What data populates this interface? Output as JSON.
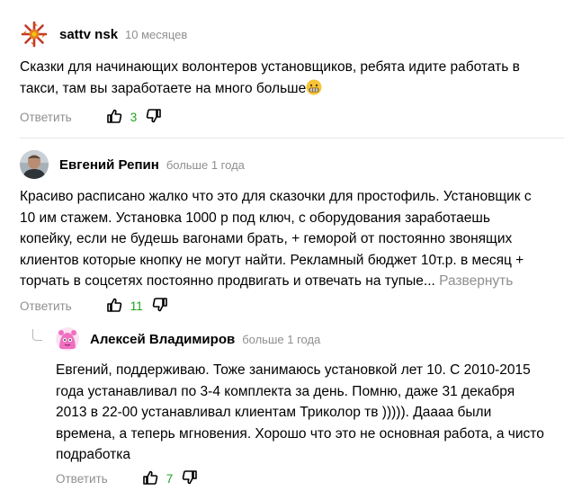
{
  "comments": [
    {
      "author": "sattv nsk",
      "date": "10 месяцев",
      "lines": [
        "Сказки для начинающих волонтеров установщиков, ребята идите работать в",
        "такси, там вы заработаете на много больше"
      ],
      "reply_label": "Ответить",
      "likes": "3"
    },
    {
      "author": "Евгений Репин",
      "date": "больше 1 года",
      "lines": [
        "Красиво расписано жалко что это для сказочки для простофиль. Установщик с",
        "10 им стажем. Установка 1000 р под ключ, с оборудования заработаешь",
        "копейку, если не будешь вагонами брать, + геморой от постоянно звонящих",
        "клиентов которые кнопку не могут найти. Рекламный бюджет 10т.р. в месяц +",
        "торчать в соцсетях постоянно продвигать и отвечать на тупые..."
      ],
      "expand_label": "Развернуть",
      "reply_label": "Ответить",
      "likes": "11"
    },
    {
      "author": "Алексей Владимиров",
      "date": "больше 1 года",
      "lines": [
        "Евгений, поддерживаю. Тоже занимаюсь установкой лет 10. С 2010-2015",
        "года устанавливал по 3-4 комплекта за день. Помню, даже 31 декабря",
        "2013 в 22-00 устанавливал клиентам Триколор тв ))))). Даааа были",
        "времена, а теперь мгновения. Хорошо что это не основная работа, а чисто",
        "подработка"
      ],
      "reply_label": "Ответить",
      "likes": "7"
    }
  ],
  "colors": {
    "muted": "#8f8f8f",
    "likes": "#1ea31e",
    "divider": "#e6e6e6"
  },
  "icons": [
    "sun-ornament-avatar-icon",
    "user-photo-avatar",
    "pink-creature-avatar-icon",
    "thumb-up-icon",
    "thumb-down-icon",
    "grimace-emoji-icon",
    "thread-reply-icon"
  ]
}
